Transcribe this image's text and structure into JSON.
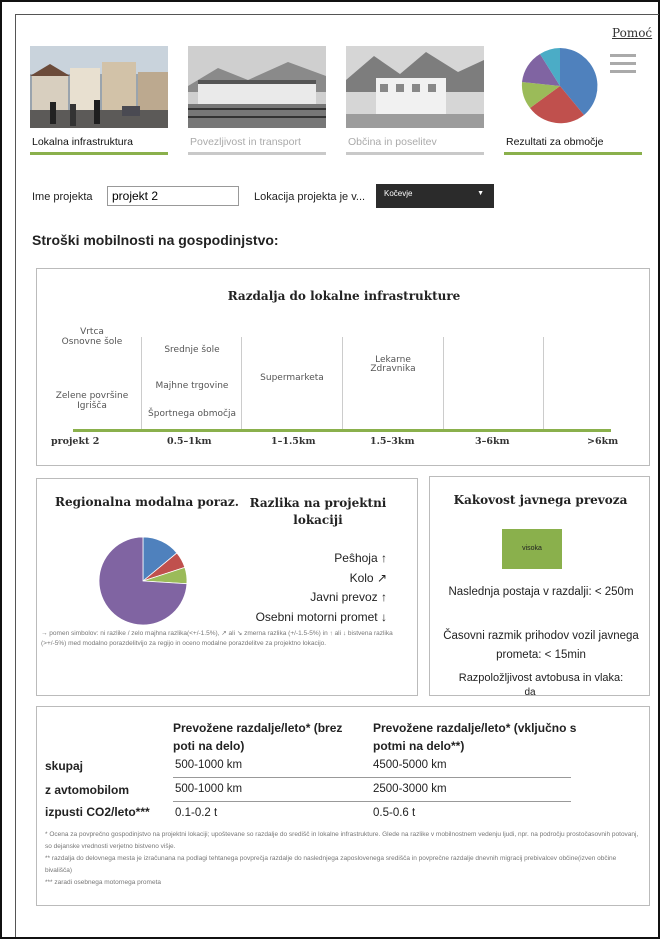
{
  "help": "Pomoć",
  "tabs": [
    {
      "label": "Lokalna infrastruktura",
      "state": "active"
    },
    {
      "label": "Povezljivost in transport",
      "state": "inactive"
    },
    {
      "label": "Občina in poselitev",
      "state": "inactive"
    },
    {
      "label": "Rezultati za območje",
      "state": "active"
    }
  ],
  "project": {
    "name_label": "Ime projekta",
    "name_value": "projekt 2",
    "location_label": "Lokacija projekta je v...",
    "location_value": "Kočevje"
  },
  "section_title": "Stroški mobilnosti na gospodinjstvo:",
  "distance": {
    "title": "Razdalja do lokalne infrastrukture",
    "col0_top": [
      "Vrtca",
      "Osnovne šole"
    ],
    "col0_bottom": [
      "Zelene površine",
      "Igrišča"
    ],
    "col1": [
      "Srednje šole",
      "Majhne trgovine",
      "Športnega območja"
    ],
    "col2": [
      "Supermarketa"
    ],
    "col3": [
      "Lekarne",
      "Zdravnika"
    ],
    "ticks": [
      "projekt 2",
      "0.5–1km",
      "1–1.5km",
      "1.5–3km",
      "3–6km",
      ">6km"
    ]
  },
  "modal": {
    "title_left": "Regionalna modalna poraz.",
    "title_right": "Razlika na projektni lokaciji",
    "modes": [
      {
        "label": "Peŝhoja",
        "arrow": "↑"
      },
      {
        "label": "Kolo",
        "arrow": "↗"
      },
      {
        "label": "Javni prevoz",
        "arrow": "↑"
      },
      {
        "label": "Osebni motorni promet",
        "arrow": "↓"
      }
    ],
    "note": "→ pomen simbolov: ni razlike / zelo majhna razlika(<+/-1.5%), ↗ ali ↘ zmerna razlika (+/-1.5-5%) in ↑ ali ↓ bistvena razlika (>+/-5%) med modalno porazdelitvijo za regijo in oceno modalne porazdelitve za projektno lokacijo."
  },
  "chart_data": {
    "type": "pie",
    "categories": [
      "Peŝhoja",
      "Kolo",
      "Javni prevoz",
      "Osebni motorni promet"
    ],
    "values": [
      14,
      6,
      6,
      74
    ],
    "colors": [
      "#4f81bd",
      "#c0504d",
      "#9bbb59",
      "#8064a2"
    ]
  },
  "transit": {
    "title": "Kakovost javnega prevoza",
    "quality": "visoka",
    "next_stop": "Naslednja postaja v razdalji: < 250m",
    "interval": "Časovni razmik prihodov vozil javnega prometa: < 15min",
    "availability": "Razpoložljivost avtobusa in vlaka:",
    "availability_value": "da"
  },
  "distances_table": {
    "head1": "Prevožene razdalje/leto* (brez poti na delo)",
    "head2": "Prevožene razdalje/leto* (vključno s potmi na delo**)",
    "rows": [
      {
        "label": "skupaj",
        "v1": "500-1000 km",
        "v2": "4500-5000 km"
      },
      {
        "label": "z avtomobilom",
        "v1": "500-1000 km",
        "v2": "2500-3000 km"
      },
      {
        "label": "izpusti CO2/leto***",
        "v1": "0.1-0.2 t",
        "v2": "0.5-0.6 t"
      }
    ],
    "notes": [
      "* Ocena za povprečno gospodinjstvo na projektni lokaciji; upoštevane so razdalje do središč in lokalne infrastrukture. Glede na razlike v mobilnostnem vedenju ljudi, npr. na področju prostočasovnih potovanj, so dejanske vrednosti verjetno bistveno višje.",
      "** razdalja do delovnega mesta je izračunana na podlagi tehtanega povprečja razdalje do naslednjega zaposlovenega središča in povprečne razdalje dnevnih migracij prebivalcev občine(izven občine bivališča)",
      "*** zaradi osebnega motornega prometa"
    ]
  }
}
